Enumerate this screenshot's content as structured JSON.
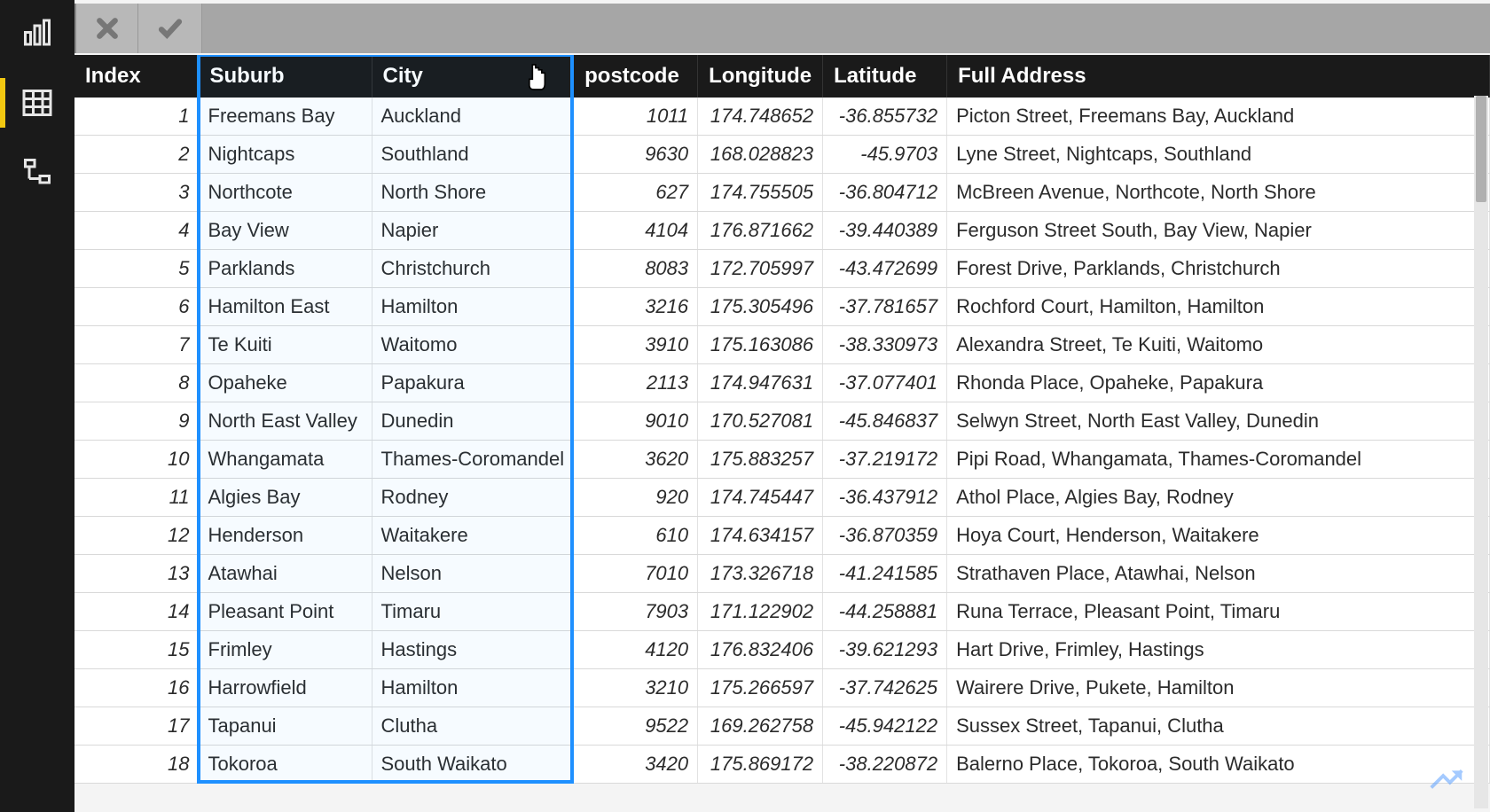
{
  "rail": {
    "report": "report-view-icon",
    "data": "data-view-icon",
    "model": "model-view-icon"
  },
  "formula_bar": {
    "cancel_label": "Cancel",
    "commit_label": "Commit",
    "value": ""
  },
  "columns": {
    "index": "Index",
    "suburb": "Suburb",
    "city": "City",
    "postcode": "postcode",
    "longitude": "Longitude",
    "latitude": "Latitude",
    "full_address": "Full Address"
  },
  "rows": [
    {
      "index": "1",
      "suburb": "Freemans Bay",
      "city": "Auckland",
      "postcode": "1011",
      "lon": "174.748652",
      "lat": "-36.855732",
      "full": "Picton Street, Freemans Bay, Auckland"
    },
    {
      "index": "2",
      "suburb": "Nightcaps",
      "city": "Southland",
      "postcode": "9630",
      "lon": "168.028823",
      "lat": "-45.9703",
      "full": "Lyne Street, Nightcaps, Southland"
    },
    {
      "index": "3",
      "suburb": "Northcote",
      "city": "North Shore",
      "postcode": "627",
      "lon": "174.755505",
      "lat": "-36.804712",
      "full": "McBreen Avenue, Northcote, North Shore"
    },
    {
      "index": "4",
      "suburb": "Bay View",
      "city": "Napier",
      "postcode": "4104",
      "lon": "176.871662",
      "lat": "-39.440389",
      "full": "Ferguson Street South, Bay View, Napier"
    },
    {
      "index": "5",
      "suburb": "Parklands",
      "city": "Christchurch",
      "postcode": "8083",
      "lon": "172.705997",
      "lat": "-43.472699",
      "full": "Forest Drive, Parklands, Christchurch"
    },
    {
      "index": "6",
      "suburb": "Hamilton East",
      "city": "Hamilton",
      "postcode": "3216",
      "lon": "175.305496",
      "lat": "-37.781657",
      "full": "Rochford Court, Hamilton, Hamilton"
    },
    {
      "index": "7",
      "suburb": "Te Kuiti",
      "city": "Waitomo",
      "postcode": "3910",
      "lon": "175.163086",
      "lat": "-38.330973",
      "full": "Alexandra Street, Te Kuiti, Waitomo"
    },
    {
      "index": "8",
      "suburb": "Opaheke",
      "city": "Papakura",
      "postcode": "2113",
      "lon": "174.947631",
      "lat": "-37.077401",
      "full": "Rhonda Place, Opaheke, Papakura"
    },
    {
      "index": "9",
      "suburb": "North East Valley",
      "city": "Dunedin",
      "postcode": "9010",
      "lon": "170.527081",
      "lat": "-45.846837",
      "full": "Selwyn Street, North East Valley, Dunedin"
    },
    {
      "index": "10",
      "suburb": "Whangamata",
      "city": "Thames-Coromandel",
      "postcode": "3620",
      "lon": "175.883257",
      "lat": "-37.219172",
      "full": "Pipi Road, Whangamata, Thames-Coromandel"
    },
    {
      "index": "11",
      "suburb": "Algies Bay",
      "city": "Rodney",
      "postcode": "920",
      "lon": "174.745447",
      "lat": "-36.437912",
      "full": "Athol Place, Algies Bay, Rodney"
    },
    {
      "index": "12",
      "suburb": "Henderson",
      "city": "Waitakere",
      "postcode": "610",
      "lon": "174.634157",
      "lat": "-36.870359",
      "full": "Hoya Court, Henderson, Waitakere"
    },
    {
      "index": "13",
      "suburb": "Atawhai",
      "city": "Nelson",
      "postcode": "7010",
      "lon": "173.326718",
      "lat": "-41.241585",
      "full": "Strathaven Place, Atawhai, Nelson"
    },
    {
      "index": "14",
      "suburb": "Pleasant Point",
      "city": "Timaru",
      "postcode": "7903",
      "lon": "171.122902",
      "lat": "-44.258881",
      "full": "Runa Terrace, Pleasant Point, Timaru"
    },
    {
      "index": "15",
      "suburb": "Frimley",
      "city": "Hastings",
      "postcode": "4120",
      "lon": "176.832406",
      "lat": "-39.621293",
      "full": "Hart Drive, Frimley, Hastings"
    },
    {
      "index": "16",
      "suburb": "Harrowfield",
      "city": "Hamilton",
      "postcode": "3210",
      "lon": "175.266597",
      "lat": "-37.742625",
      "full": "Wairere Drive, Pukete, Hamilton"
    },
    {
      "index": "17",
      "suburb": "Tapanui",
      "city": "Clutha",
      "postcode": "9522",
      "lon": "169.262758",
      "lat": "-45.942122",
      "full": "Sussex Street, Tapanui, Clutha"
    },
    {
      "index": "18",
      "suburb": "Tokoroa",
      "city": "South Waikato",
      "postcode": "3420",
      "lon": "175.869172",
      "lat": "-38.220872",
      "full": "Balerno Place, Tokoroa, South Waikato"
    }
  ],
  "selection": {
    "columns": [
      "suburb",
      "city"
    ]
  },
  "cursor_alt": "pointer-cursor"
}
